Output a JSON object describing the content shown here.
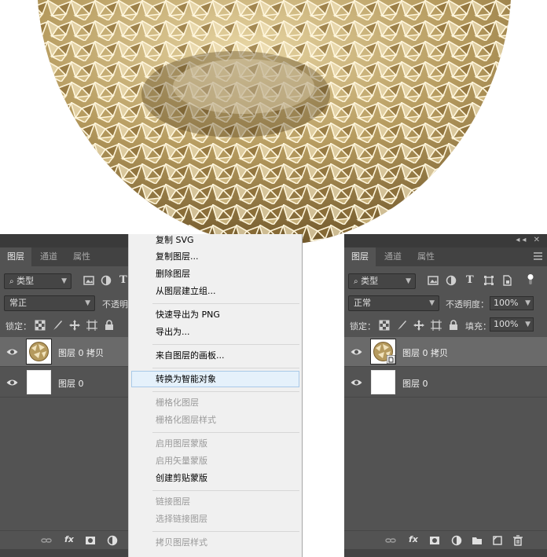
{
  "left_panel": {
    "tabs": [
      "图层",
      "通道",
      "属性"
    ],
    "filter_label": "类型",
    "blend_mode": "常正",
    "opacity_label": "不透明",
    "lock_label": "锁定：",
    "layers": [
      {
        "name": "图层 0 拷贝"
      },
      {
        "name": "图层 0"
      }
    ]
  },
  "context_menu": {
    "items": [
      {
        "label": "复制 SVG",
        "enabled": true
      },
      {
        "label": "复制图层...",
        "enabled": true
      },
      {
        "label": "删除图层",
        "enabled": true
      },
      {
        "label": "从图层建立组...",
        "enabled": true
      },
      {
        "label": "快速导出为 PNG",
        "enabled": true
      },
      {
        "label": "导出为...",
        "enabled": true
      },
      {
        "label": "来自图层的画板...",
        "enabled": true
      },
      {
        "label": "转换为智能对象",
        "enabled": true,
        "highlighted": true
      },
      {
        "label": "栅格化图层",
        "enabled": false
      },
      {
        "label": "栅格化图层样式",
        "enabled": false
      },
      {
        "label": "启用图层蒙版",
        "enabled": false
      },
      {
        "label": "启用矢量蒙版",
        "enabled": false
      },
      {
        "label": "创建剪贴蒙版",
        "enabled": true
      },
      {
        "label": "链接图层",
        "enabled": false
      },
      {
        "label": "选择链接图层",
        "enabled": false
      },
      {
        "label": "拷贝图层样式",
        "enabled": false
      }
    ]
  },
  "right_panel": {
    "tabs": [
      "图层",
      "通道",
      "属性"
    ],
    "filter_label": "类型",
    "blend_mode": "正常",
    "opacity_label": "不透明度：",
    "opacity_value": "100%",
    "lock_label": "锁定：",
    "fill_label": "填充：",
    "fill_value": "100%",
    "layers": [
      {
        "name": "图层 0 拷贝"
      },
      {
        "name": "图层 0"
      }
    ]
  },
  "colors": {
    "panel_bg": "#535353",
    "selected_row": "#6a6a6a",
    "menu_bg": "#f0f0f0",
    "menu_highlight": "#e5f1fb",
    "sphere_gold": "#b59a5e"
  }
}
